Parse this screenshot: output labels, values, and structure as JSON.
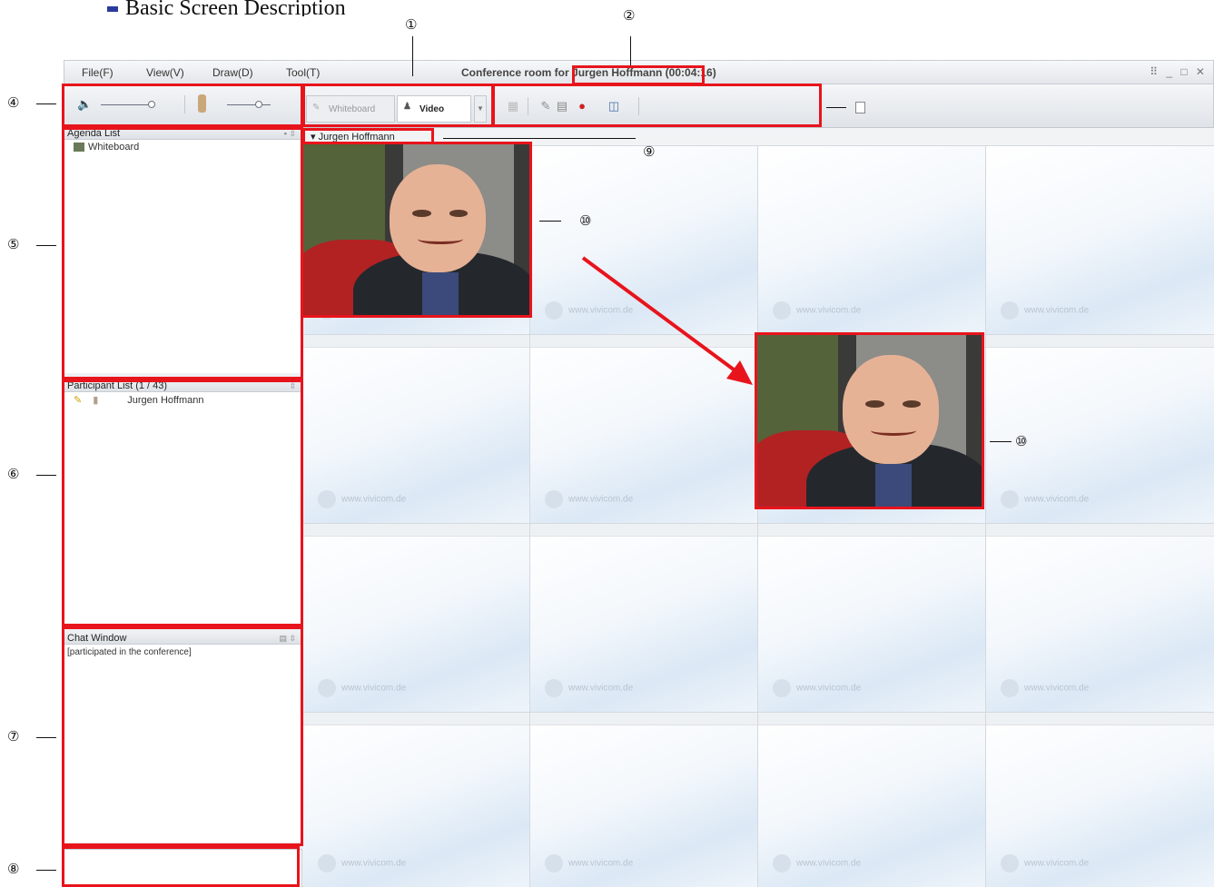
{
  "doc": {
    "title": "Basic Screen Description"
  },
  "app": {
    "menu": [
      "File(F)",
      "View(V)",
      "Draw(D)",
      "Tool(T)"
    ],
    "window_title": "Conference room for Jurgen Hoffmann (00:04:16)",
    "window_controls": "⠿ _ □ ✕"
  },
  "toolbar": {
    "tabs": [
      {
        "label": "Whiteboard",
        "active": false
      },
      {
        "label": "Video",
        "active": true
      }
    ]
  },
  "panels": {
    "agenda": {
      "title": "Agenda List",
      "items": [
        "Whiteboard"
      ]
    },
    "participants": {
      "title": "Participant List (1 / 43)",
      "items": [
        "Jurgen Hoffmann"
      ]
    },
    "chat": {
      "title": "Chat Window",
      "messages": [
        "[participated in the conference]"
      ]
    }
  },
  "video": {
    "current_speaker": "Jurgen Hoffmann",
    "watermark": "www.vivicom.de"
  },
  "annotations": {
    "n1": "①",
    "n2": "②",
    "n4": "④",
    "n5": "⑤",
    "n6": "⑥",
    "n7": "⑦",
    "n8": "⑧",
    "n9": "⑨",
    "n10a": "⑩",
    "n10b": "⑩"
  },
  "colors": {
    "annotation_red": "#e8141c",
    "chair_red": "#b22222"
  }
}
